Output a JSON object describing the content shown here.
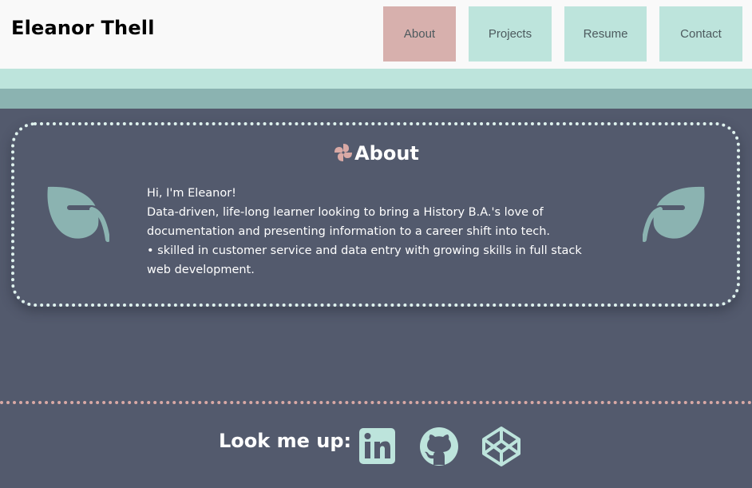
{
  "header": {
    "site_title": "Eleanor Thell",
    "nav": {
      "about": "About",
      "projects": "Projects",
      "resume": "Resume",
      "contact": "Contact"
    },
    "active_nav": "about"
  },
  "about": {
    "heading": "About",
    "heading_icon": "pinwheel-icon",
    "decor_icon": "leaf-icon",
    "lines": [
      "Hi, I'm Eleanor!",
      "Data-driven, life-long learner looking to bring a History B.A.'s love of documentation and presenting information to a career shift into tech.",
      "• skilled in customer service and data entry with growing skills in full stack web development."
    ]
  },
  "footer": {
    "label": "Look me up:",
    "social_icons": [
      "linkedin-icon",
      "github-icon",
      "codepen-icon"
    ]
  },
  "colors": {
    "page_background": "#535a6d",
    "header_background": "#f9f9f9",
    "nav_button": "#bde4dc",
    "nav_button_active": "#d7b0ad",
    "band_light": "#bde4dc",
    "band_mid": "#8bb3b1",
    "leaf": "#8bb3b1",
    "social_icon": "#bde4dc",
    "pinwheel": "#d9a9a5",
    "footer_divider": "#d9a9a5",
    "card_border": "#dff2ee"
  }
}
